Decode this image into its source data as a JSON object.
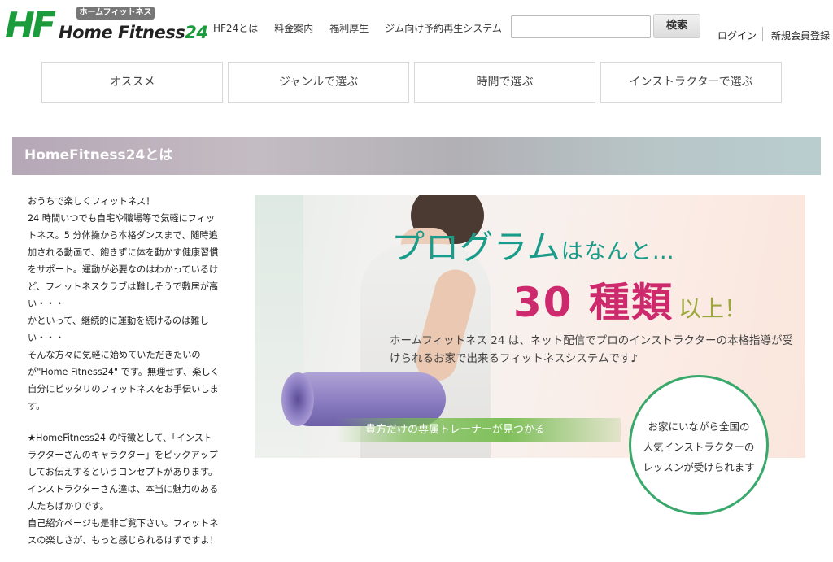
{
  "logo": {
    "mark": "HF",
    "kana": "ホームフィットネス24",
    "brand_text": "Home Fitness",
    "brand_num": "24"
  },
  "nav": {
    "items": [
      "HF24とは",
      "料金案内",
      "福利厚生",
      "ジム向け予約再生システム"
    ]
  },
  "search": {
    "value": "",
    "placeholder": "",
    "button_label": "検索"
  },
  "account": {
    "login": "ログイン",
    "register": "新規会員登録"
  },
  "tabs": [
    "オススメ",
    "ジャンルで選ぶ",
    "時間で選ぶ",
    "インストラクターで選ぶ"
  ],
  "section": {
    "title": "HomeFitness24とは"
  },
  "intro": {
    "paragraph1": [
      "おうちで楽しくフィットネス！",
      "24 時間いつでも自宅や職場等で気軽にフィットネス。5 分体操から本格ダンスまで、随時追加される動画で、飽きずに体を動かす健康習慣をサポート。運動が必要なのはわかっているけど、フィットネスクラブは難しそうで敷居が高い・・・",
      "かといって、継続的に運動を続けるのは難しい・・・",
      "そんな方々に気軽に始めていただきたいのが\"Home Fitness24\" です。無理せず、楽しく自分にピッタリのフィットネスをお手伝いします。"
    ],
    "paragraph2": [
      "★HomeFitness24 の特徴として、「インストラクターさんのキャラクター」をピックアップしてお伝えするというコンセプトがあります。インストラクターさん達は、本当に魅力のある人たちばかりです。",
      "自己紹介ページも是非ご覧下さい。フィットネスの楽しさが、もっと感じられるはずですよ！"
    ]
  },
  "hero": {
    "headline1_main": "プログラム",
    "headline1_rest": "はなんと…",
    "headline2_big": "30 種類",
    "headline2_small": "以上！",
    "description": "ホームフィットネス 24 は、ネット配信でプロのインストラクターの本格指導が受けられるお家で出来るフィットネスシステムです♪",
    "band_text": "貴方だけの専属トレーナーが見つかる",
    "circle_lines": [
      "お家にいながら全国の",
      "人気インストラクターの",
      "レッスンが受けられます"
    ]
  },
  "colors": {
    "brand_green": "#1a9b3c",
    "headline_teal": "#1a9c8a",
    "headline_pink": "#cc2a6c",
    "accent_olive": "#9ca83a",
    "circle_border": "#39a86b"
  }
}
